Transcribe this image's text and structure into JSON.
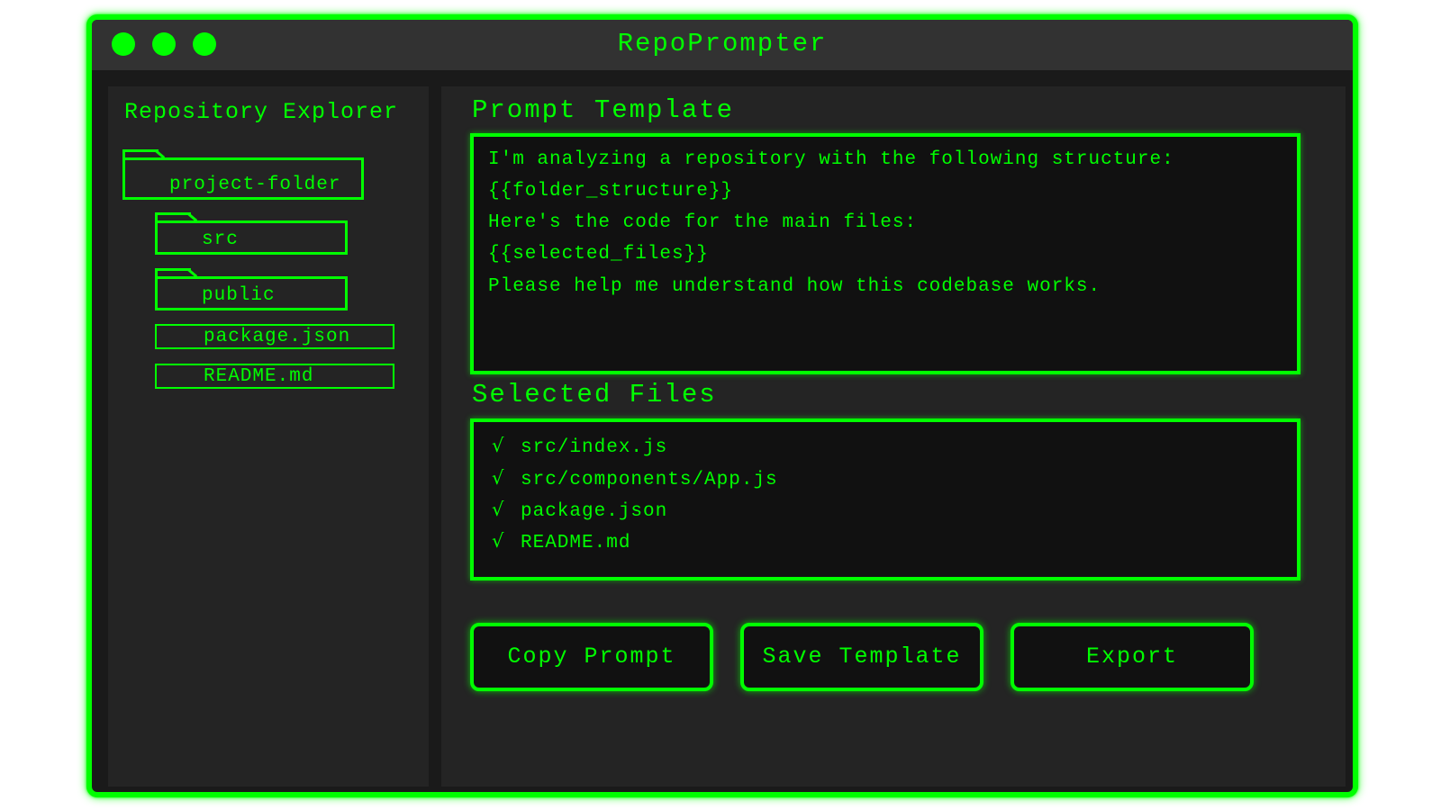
{
  "window": {
    "title": "RepoPrompter"
  },
  "colors": {
    "accent": "#00ff00",
    "background": "#1a1a1a",
    "panel": "#242424",
    "titlebar": "#323232"
  },
  "sidebar": {
    "title": "Repository Explorer",
    "items": [
      {
        "type": "folder",
        "label": "project-folder",
        "icon": "folder-icon"
      },
      {
        "type": "folder",
        "label": "src",
        "icon": "folder-icon"
      },
      {
        "type": "folder",
        "label": "public",
        "icon": "folder-icon"
      },
      {
        "type": "file",
        "label": "package.json",
        "icon": "file-icon"
      },
      {
        "type": "file",
        "label": "README.md",
        "icon": "file-icon"
      }
    ]
  },
  "template": {
    "title": "Prompt Template",
    "lines": [
      "I'm analyzing a repository with the following structure:",
      "{{folder_structure}}",
      "Here's the code for the main files:",
      "{{selected_files}}",
      "Please help me understand how this codebase works."
    ]
  },
  "selected": {
    "title": "Selected Files",
    "check_glyph": "√",
    "files": [
      "src/index.js",
      "src/components/App.js",
      "package.json",
      "README.md"
    ]
  },
  "actions": {
    "copy_label": "Copy Prompt",
    "save_label": "Save Template",
    "export_label": "Export"
  }
}
